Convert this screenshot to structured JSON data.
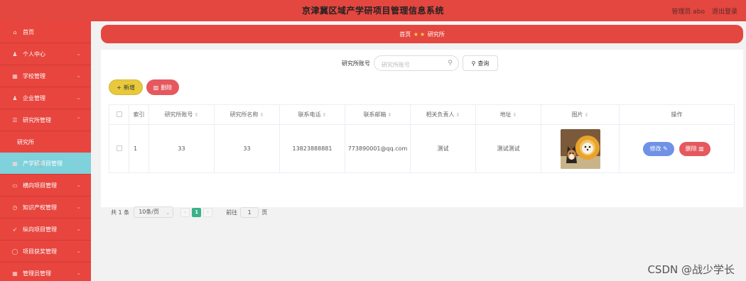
{
  "header": {
    "title": "京津冀区域产学研项目管理信息系统",
    "user": "管理员 abo",
    "logout": "退出登录"
  },
  "sidebar": {
    "items": [
      {
        "label": "首页",
        "icon": "home-icon"
      },
      {
        "label": "个人中心",
        "icon": "user-icon"
      },
      {
        "label": "学校管理",
        "icon": "school-icon"
      },
      {
        "label": "企业管理",
        "icon": "user-icon"
      },
      {
        "label": "研究所管理",
        "icon": "list-icon"
      },
      {
        "label": "研究所",
        "sub": true
      },
      {
        "label": "产学研项目管理",
        "icon": "grid-icon"
      },
      {
        "label": "横向项目管理",
        "icon": "doc-icon"
      },
      {
        "label": "知识产权管理",
        "icon": "clock-icon"
      },
      {
        "label": "纵向项目管理",
        "icon": "send-icon"
      },
      {
        "label": "项目获奖管理",
        "icon": "circle-icon"
      },
      {
        "label": "管理员管理",
        "icon": "grid-icon"
      }
    ]
  },
  "breadcrumb": {
    "home": "首页",
    "current": "研究所"
  },
  "search": {
    "label": "研究所账号",
    "placeholder": "研究所账号",
    "button": "查询"
  },
  "actions": {
    "add": "新增",
    "delete": "删除"
  },
  "table": {
    "headers": [
      "索引",
      "研究所账号",
      "研究所名称",
      "联系电话",
      "联系邮箱",
      "相关负责人",
      "地址",
      "图片",
      "操作"
    ],
    "rows": [
      {
        "index": "1",
        "account": "33",
        "name": "33",
        "phone": "13823888881",
        "email": "773890001@qq.com",
        "manager": "测试",
        "address": "测试测试",
        "edit": "修改",
        "delete": "删除"
      }
    ]
  },
  "pagination": {
    "total": "共 1 条",
    "page_size": "10条/页",
    "current": "1",
    "goto_prefix": "前往",
    "goto_value": "1",
    "goto_suffix": "页"
  },
  "watermark": "CSDN @战少学长",
  "colors": {
    "primary": "#e34740",
    "active_nav": "#7fd1dc",
    "add_button": "#e8c93c",
    "danger": "#e5585e",
    "edit_button": "#6f92e7",
    "page_active": "#38b28b"
  }
}
